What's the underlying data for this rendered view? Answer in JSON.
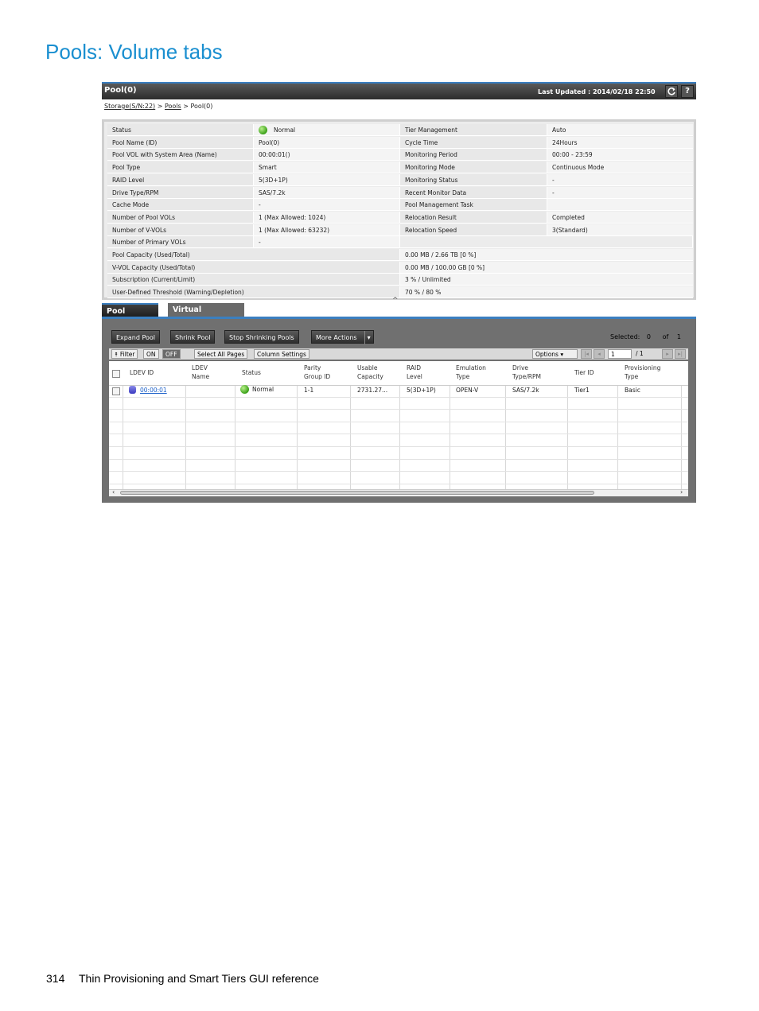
{
  "page": {
    "heading": "Pools: Volume tabs",
    "footer_page": "314",
    "footer_text": "Thin Provisioning and Smart Tiers GUI reference"
  },
  "window": {
    "title": "Pool(0)",
    "last_updated": "Last Updated : 2014/02/18 22:50",
    "refresh_icon": "refresh-icon",
    "help_label": "?"
  },
  "breadcrumb": {
    "storage": "Storage(S/N:22)",
    "sep1": ">",
    "pools": "Pools",
    "sep2": ">",
    "current": "Pool(0)"
  },
  "info": {
    "rows": [
      {
        "l1": "Status",
        "v1": "Normal",
        "l2": "Tier Management",
        "v2": "Auto"
      },
      {
        "l1": "Pool Name (ID)",
        "v1": "Pool(0)",
        "l2": "Cycle Time",
        "v2": "24Hours"
      },
      {
        "l1": "Pool VOL with System Area (Name)",
        "v1": "00:00:01()",
        "l2": "Monitoring Period",
        "v2": "00:00 - 23:59"
      },
      {
        "l1": "Pool Type",
        "v1": "Smart",
        "l2": "Monitoring Mode",
        "v2": "Continuous Mode"
      },
      {
        "l1": "RAID Level",
        "v1": "5(3D+1P)",
        "l2": "Monitoring Status",
        "v2": "-"
      },
      {
        "l1": "Drive Type/RPM",
        "v1": "SAS/7.2k",
        "l2": "Recent Monitor Data",
        "v2": "-"
      },
      {
        "l1": "Cache Mode",
        "v1": "-",
        "l2": "Pool Management Task",
        "v2": ""
      },
      {
        "l1": "Number of Pool VOLs",
        "v1": "1 (Max Allowed: 1024)",
        "l2": "Relocation Result",
        "v2": "Completed"
      },
      {
        "l1": "Number of V-VOLs",
        "v1": "1 (Max Allowed: 63232)",
        "l2": "Relocation Speed",
        "v2": "3(Standard)"
      },
      {
        "l1": "Number of Primary VOLs",
        "v1": "-",
        "l2": "",
        "v2": ""
      }
    ],
    "wide_rows": [
      {
        "label": "Pool Capacity (Used/Total)",
        "value": "0.00 MB / 2.66 TB [0 %]"
      },
      {
        "label": "V-VOL Capacity (Used/Total)",
        "value": "0.00 MB / 100.00 GB [0 %]"
      },
      {
        "label": "Subscription (Current/Limit)",
        "value": "3 % / Unlimited"
      },
      {
        "label": "User-Defined Threshold (Warning/Depletion)",
        "value": "70 % / 80 %"
      }
    ],
    "collapse_glyph": "^"
  },
  "tabs": {
    "pool_volumes": "Pool Volumes",
    "virtual_volumes": "Virtual Volumes"
  },
  "toolbar": {
    "expand_pool": "Expand Pool",
    "shrink_pool": "Shrink Pool",
    "stop_shrinking": "Stop Shrinking Pools",
    "more_actions": "More Actions",
    "selected_label": "Selected:",
    "selected_count": "0",
    "of_label": "of",
    "total_count": "1"
  },
  "filterbar": {
    "filter": "⯭ Filter",
    "on": "ON",
    "off": "OFF",
    "select_all_pages": "Select All Pages",
    "column_settings": "Column Settings",
    "options": "Options ▾",
    "page_input": "1",
    "page_total": "/ 1"
  },
  "table": {
    "headers": [
      {
        "line1": "LDEV ID",
        "line2": ""
      },
      {
        "line1": "LDEV",
        "line2": "Name"
      },
      {
        "line1": "Status",
        "line2": ""
      },
      {
        "line1": "Parity",
        "line2": "Group ID"
      },
      {
        "line1": "Usable",
        "line2": "Capacity"
      },
      {
        "line1": "RAID",
        "line2": "Level"
      },
      {
        "line1": "Emulation",
        "line2": "Type"
      },
      {
        "line1": "Drive",
        "line2": "Type/RPM"
      },
      {
        "line1": "Tier ID",
        "line2": ""
      },
      {
        "line1": "Provisioning",
        "line2": "Type"
      }
    ],
    "rows": [
      {
        "ldev_id": "00:00:01",
        "ldev_name": "",
        "status": "Normal",
        "parity_group": "1-1",
        "usable_capacity": "2731.27...",
        "raid_level": "5(3D+1P)",
        "emulation": "OPEN-V",
        "drive": "SAS/7.2k",
        "tier_id": "Tier1",
        "provisioning": "Basic"
      }
    ]
  }
}
